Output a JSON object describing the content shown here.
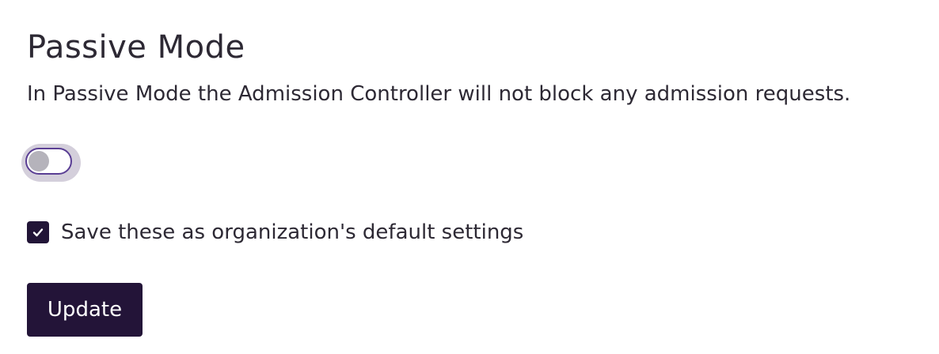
{
  "section": {
    "title": "Passive Mode",
    "description": "In Passive Mode the Admission Controller will not block any admission requests."
  },
  "toggle": {
    "state": "off",
    "track_border_color": "#5a3e94",
    "knob_color": "#b5b3bb"
  },
  "default_settings": {
    "checked": true,
    "label": "Save these as organization's default settings",
    "check_icon": "checkmark-icon"
  },
  "actions": {
    "update_label": "Update"
  },
  "colors": {
    "primary_dark": "#231438",
    "text": "#2d2934"
  }
}
